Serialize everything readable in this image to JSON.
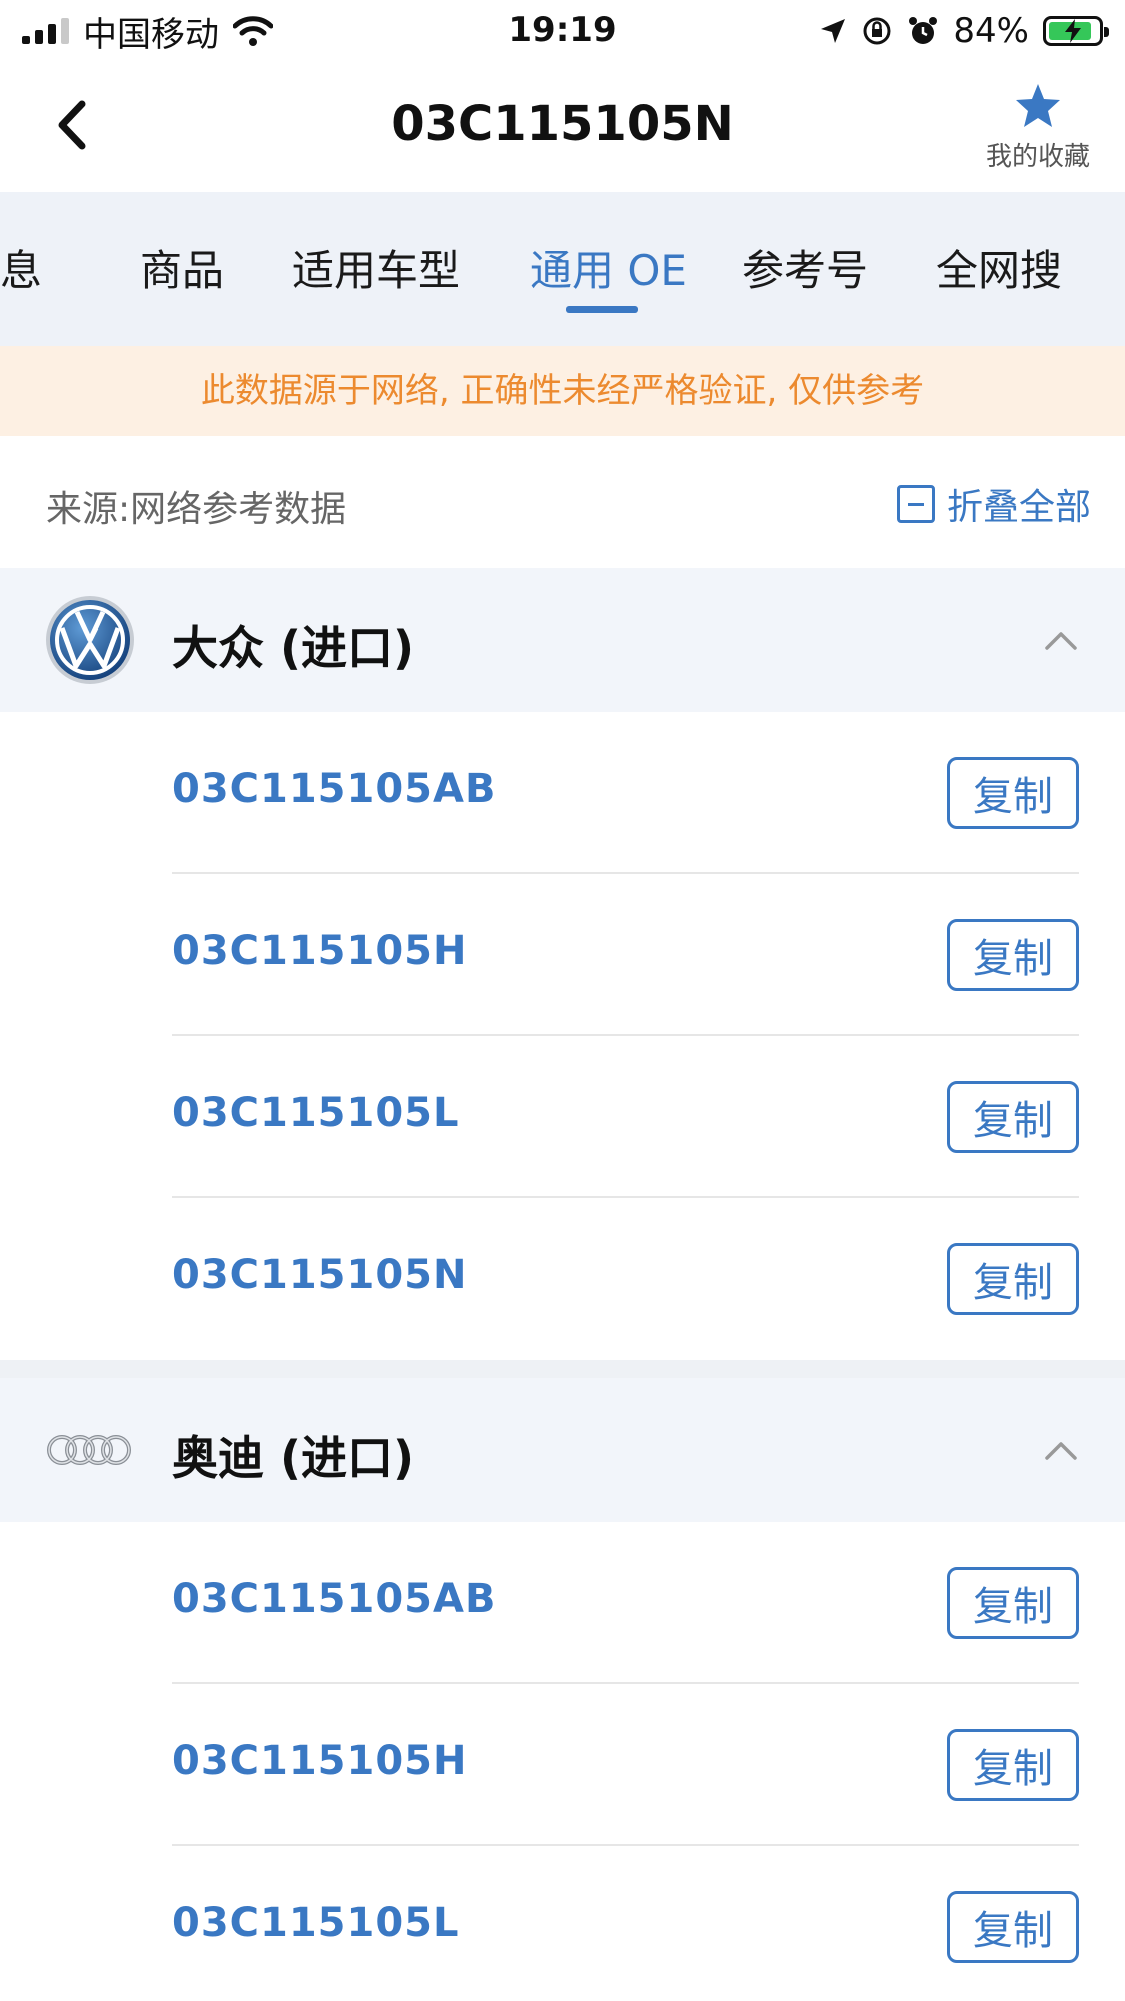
{
  "status_bar": {
    "carrier": "中国移动",
    "time": "19:19",
    "battery": "84%"
  },
  "nav": {
    "title": "03C115105N",
    "favorite_label": "我的收藏"
  },
  "tabs": [
    {
      "label": "信息"
    },
    {
      "label": "商品"
    },
    {
      "label": "适用车型"
    },
    {
      "label": "通用 OE"
    },
    {
      "label": "参考号"
    },
    {
      "label": "全网搜"
    }
  ],
  "active_tab": "通用 OE",
  "notice": "此数据源于网络, 正确性未经严格验证, 仅供参考",
  "source": {
    "label": "来源:网络参考数据",
    "collapse_label": "折叠全部"
  },
  "groups": [
    {
      "brand": "大众 (进口)",
      "logo": "vw-logo",
      "items": [
        {
          "code": "03C115105AB",
          "copy_label": "复制"
        },
        {
          "code": "03C115105H",
          "copy_label": "复制"
        },
        {
          "code": "03C115105L",
          "copy_label": "复制"
        },
        {
          "code": "03C115105N",
          "copy_label": "复制"
        }
      ]
    },
    {
      "brand": "奥迪 (进口)",
      "logo": "audi-logo",
      "items": [
        {
          "code": "03C115105AB",
          "copy_label": "复制"
        },
        {
          "code": "03C115105H",
          "copy_label": "复制"
        },
        {
          "code": "03C115105L",
          "copy_label": "复制"
        }
      ]
    }
  ],
  "colors": {
    "accent": "#3a78c3",
    "notice_bg": "#fdf0e3",
    "notice_text": "#ec8a2f",
    "tab_bg": "#eef2f8",
    "brand_header_bg": "#f2f5fa"
  }
}
